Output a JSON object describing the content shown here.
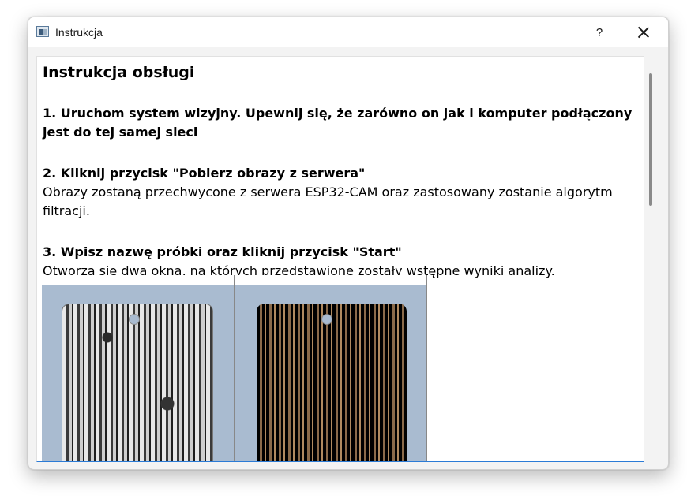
{
  "window": {
    "title": "Instrukcja",
    "help_label": "?"
  },
  "document": {
    "heading": "Instrukcja obsługi",
    "steps": [
      {
        "head": "1. Uruchom system wizyjny. Upewnij się, że zarówno on jak i komputer podłączony jest do tej samej sieci",
        "body": ""
      },
      {
        "head": "2. Kliknij przycisk \"Pobierz obrazy z serwera\"",
        "body": "Obrazy zostaną przechwycone z serwera ESP32-CAM oraz zastosowany zostanie algorytm filtracji."
      },
      {
        "head": "3. Wpisz nazwę próbki oraz kliknij przycisk \"Start\"",
        "body": "Otworzą się dwa okna, na których przedstawione zostały wstępne wyniki analizy."
      }
    ]
  }
}
